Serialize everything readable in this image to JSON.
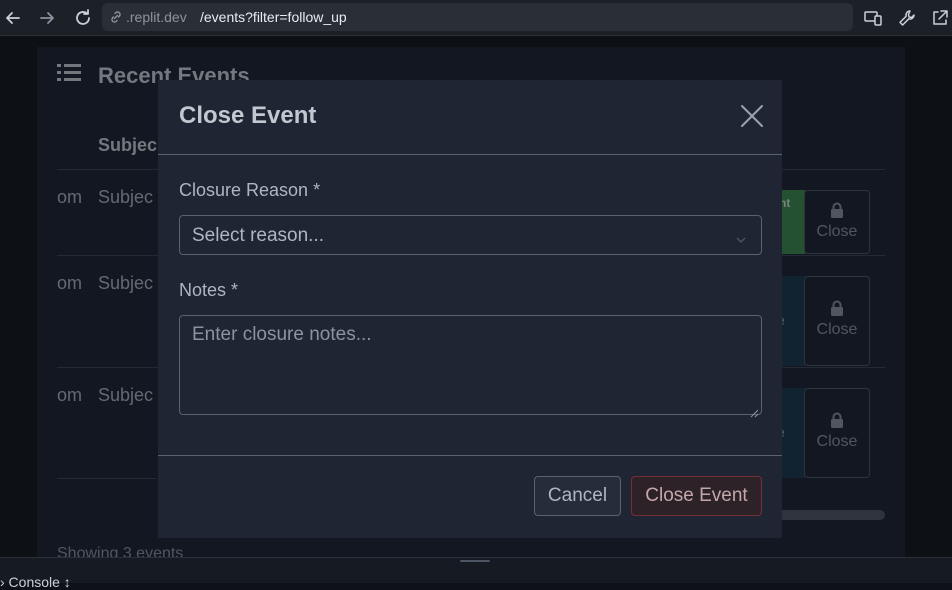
{
  "browser": {
    "url_host": ".replit.dev",
    "url_path": "/events?filter=follow_up",
    "icons": [
      "back-arrow-icon",
      "forward-arrow-icon",
      "reload-icon",
      "link-icon",
      "devices-icon",
      "wrench-icon",
      "open-external-icon"
    ]
  },
  "page": {
    "title": "Recent Events",
    "column_subject": "Subjec",
    "rows": [
      {
        "from": "om",
        "subject": "Subjec",
        "action_label": "nt",
        "close_label": "Close"
      },
      {
        "from": "om",
        "subject": "Subjec",
        "action_label": "e",
        "close_label": "Close"
      },
      {
        "from": "om",
        "subject": "Subjec",
        "action_label": "e",
        "close_label": "Close"
      }
    ],
    "footer": "Showing 3 events"
  },
  "modal": {
    "title": "Close Event",
    "reason_label": "Closure Reason *",
    "reason_placeholder": "Select reason...",
    "notes_label": "Notes *",
    "notes_placeholder": "Enter closure notes...",
    "cancel_label": "Cancel",
    "submit_label": "Close Event"
  },
  "dock": {
    "text": "› Console ↕"
  },
  "colors": {
    "accent_green": "#3a8b4e",
    "danger_border": "#7a2e34"
  }
}
